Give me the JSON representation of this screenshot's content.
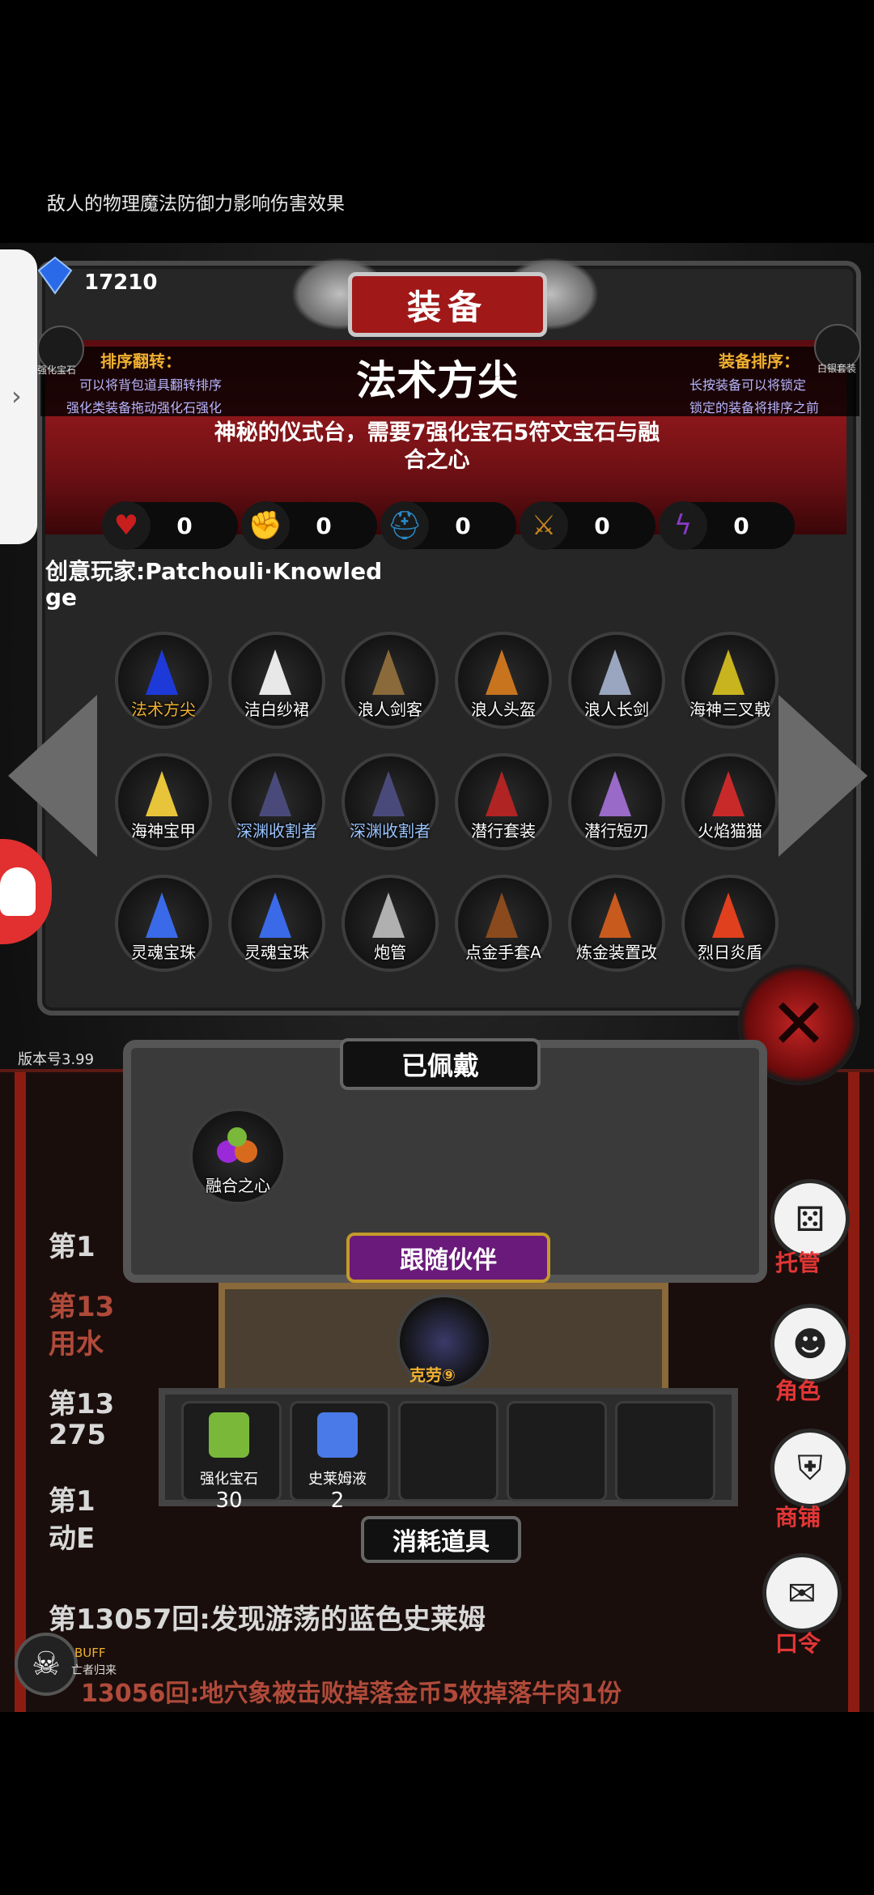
{
  "hint_text": "敌人的物理魔法防御力影响伤害效果",
  "gem_count": "17210",
  "gem_label": "宝石",
  "title": "装备",
  "sort_flip": {
    "title": "排序翻转：",
    "line1": "可以将背包道具翻转排序",
    "line2": "强化类装备拖动强化石强化"
  },
  "equip_sort": {
    "title": "装备排序：",
    "line1": "长按装备可以将锁定",
    "line2": "锁定的装备将排序之前"
  },
  "left_icon_label": "强化宝石",
  "right_icon_label": "白银套装",
  "item_name": "法术方尖",
  "item_desc": "神秘的仪式台，需要7强化宝石5符文宝石与融合之心",
  "stats": [
    {
      "icon": "heart-icon",
      "value": "0",
      "color": "#c81e1e"
    },
    {
      "icon": "strength-icon",
      "value": "0",
      "color": "#d8a21e"
    },
    {
      "icon": "helmet-icon",
      "value": "0",
      "color": "#2a8ac8"
    },
    {
      "icon": "sword-icon",
      "value": "0",
      "color": "#c8861e"
    },
    {
      "icon": "magic-icon",
      "value": "0",
      "color": "#8a3ac8"
    }
  ],
  "creator": "创意玩家:Patchouli·Knowledge",
  "items": [
    {
      "name": "法术方尖",
      "color": "#1d3ad8",
      "selected": true
    },
    {
      "name": "洁白纱裙",
      "color": "#e8e8e8"
    },
    {
      "name": "浪人剑客",
      "color": "#8a6a3a"
    },
    {
      "name": "浪人头盔",
      "color": "#c8741e"
    },
    {
      "name": "浪人长剑",
      "color": "#9aa6c0"
    },
    {
      "name": "海神三叉戟",
      "color": "#c8b41e"
    },
    {
      "name": "海神宝甲",
      "color": "#e8c43a"
    },
    {
      "name": "深渊收割者",
      "color": "#4a4a7a",
      "blue": true
    },
    {
      "name": "深渊收割者",
      "color": "#4a4a7a",
      "blue": true
    },
    {
      "name": "潜行套装",
      "color": "#b02424"
    },
    {
      "name": "潜行短刃",
      "color": "#9a6ac8"
    },
    {
      "name": "火焰猫猫",
      "color": "#c82a2a"
    },
    {
      "name": "灵魂宝珠",
      "color": "#3a6ae8"
    },
    {
      "name": "灵魂宝珠",
      "color": "#3a6ae8"
    },
    {
      "name": "炮管",
      "color": "#b0b0b0"
    },
    {
      "name": "点金手套A",
      "color": "#8a4a1e"
    },
    {
      "name": "炼金装置改",
      "color": "#c85a1e"
    },
    {
      "name": "烈日炎盾",
      "color": "#e0401e"
    }
  ],
  "version": "版本号3.99",
  "worn_label": "已佩戴",
  "worn_item": "融合之心",
  "follow_label": "跟随伙伴",
  "companion": "克劳⑨",
  "consumables": [
    {
      "name": "强化宝石",
      "count": "30"
    },
    {
      "name": "史莱姆液",
      "count": "2"
    },
    {
      "name": "",
      "count": ""
    },
    {
      "name": "",
      "count": ""
    },
    {
      "name": "",
      "count": ""
    }
  ],
  "consume_label": "消耗道具",
  "log": {
    "line1": "第1",
    "line2a": "第13",
    "line2b": "用水",
    "line3a": "第13",
    "line3b": "275",
    "line4a": "第1",
    "line4b": "动E",
    "line5": "第13057回:发现游荡的蓝色史莱姆",
    "line6": "13056回:地穴象被击败掉落金币5枚掉落牛肉1份"
  },
  "side": {
    "auto": "托管",
    "role": "角色",
    "shop": "商铺",
    "code": "口令"
  },
  "buff": {
    "title": "BUFF",
    "sub": "亡者归来"
  }
}
